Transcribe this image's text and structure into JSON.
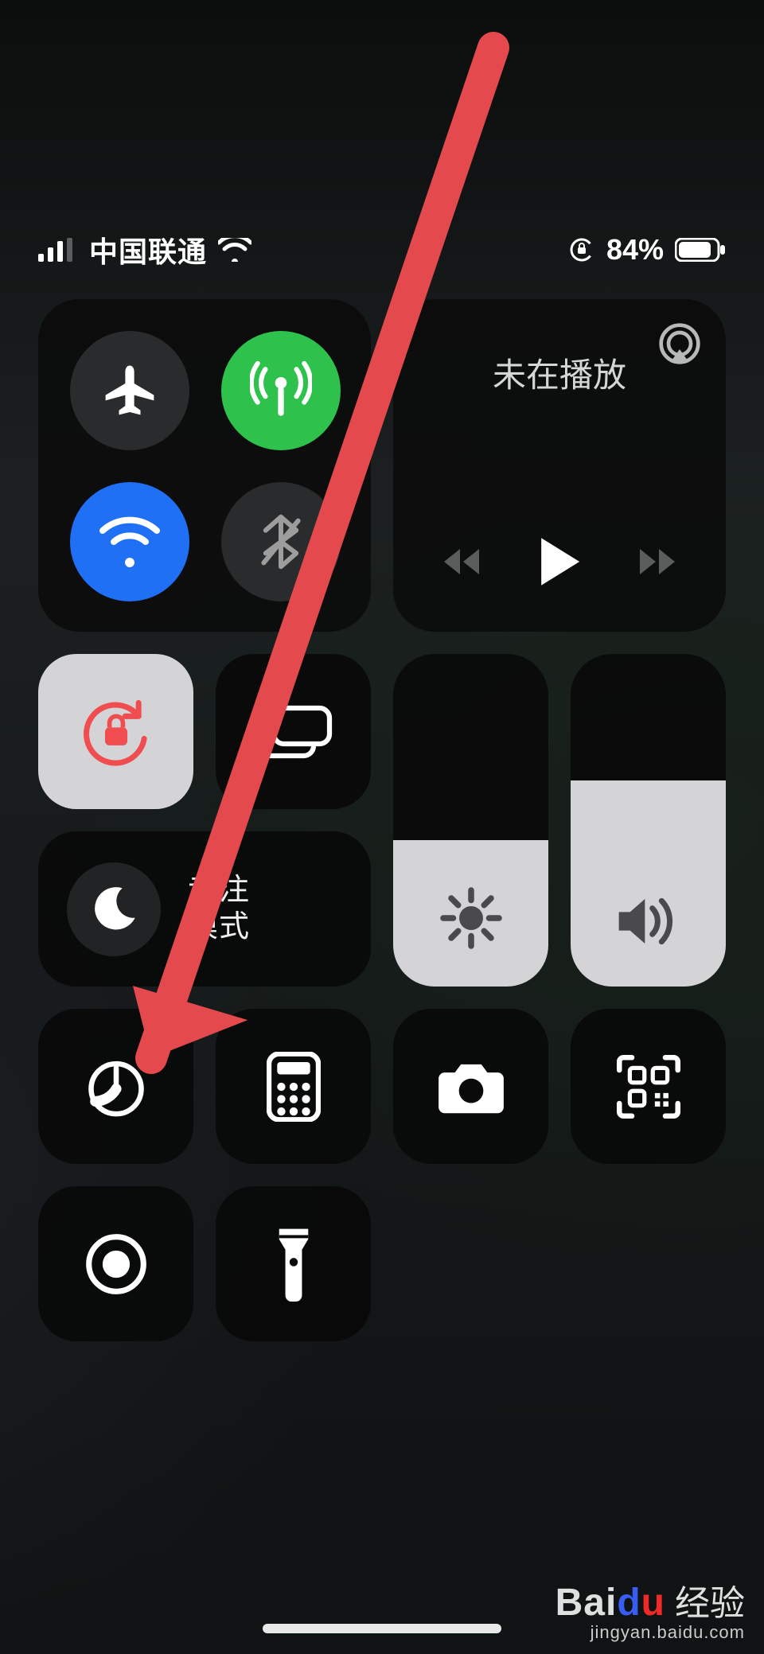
{
  "status": {
    "carrier": "中国联通",
    "battery_pct": "84%"
  },
  "media": {
    "title": "未在播放"
  },
  "focus": {
    "label_line1": "专注",
    "label_line2": "模式"
  },
  "sliders": {
    "brightness_pct": 44,
    "volume_pct": 62
  },
  "watermark": {
    "brand_prefix": "Bai",
    "brand_mid": "d",
    "brand_suffix": "u",
    "brand_cn": "经验",
    "url": "jingyan.baidu.com"
  }
}
